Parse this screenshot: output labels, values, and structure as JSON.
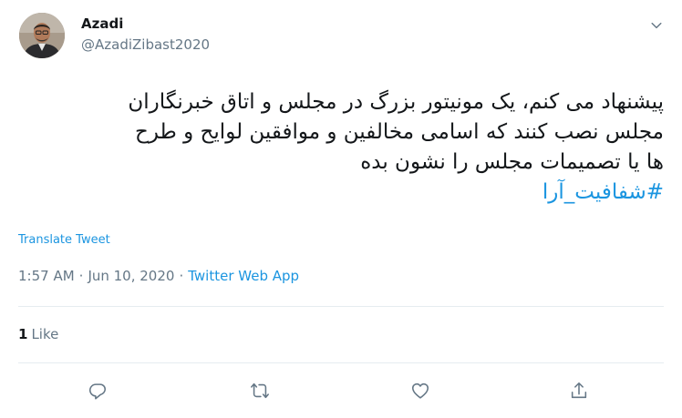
{
  "author": {
    "display_name": "Azadi",
    "handle": "@AzadiZibast2020"
  },
  "tweet": {
    "lines": [
      "پیشنهاد می کنم، یک مونیتور بزرگ در مجلس و اتاق خبرنگاران",
      "مجلس نصب کنند که اسامی مخالفین و موافقین لوایح و طرح",
      "ها یا تصمیمات مجلس را نشون بده"
    ],
    "hashtag": "#شفافیت_آرا"
  },
  "translate_label": "Translate Tweet",
  "meta": {
    "time": "1:57 AM",
    "separator": "·",
    "date": "Jun 10, 2020",
    "source": "Twitter Web App"
  },
  "engagement": {
    "like_count": "1",
    "like_label": "Like"
  },
  "icons": {
    "caret": "chevron-down-icon",
    "reply": "reply-icon",
    "retweet": "retweet-icon",
    "like": "heart-icon",
    "share": "share-icon"
  },
  "colors": {
    "link": "#1b95e0",
    "secondary_text": "#657786",
    "primary_text": "#14171a",
    "icon": "#657786"
  }
}
